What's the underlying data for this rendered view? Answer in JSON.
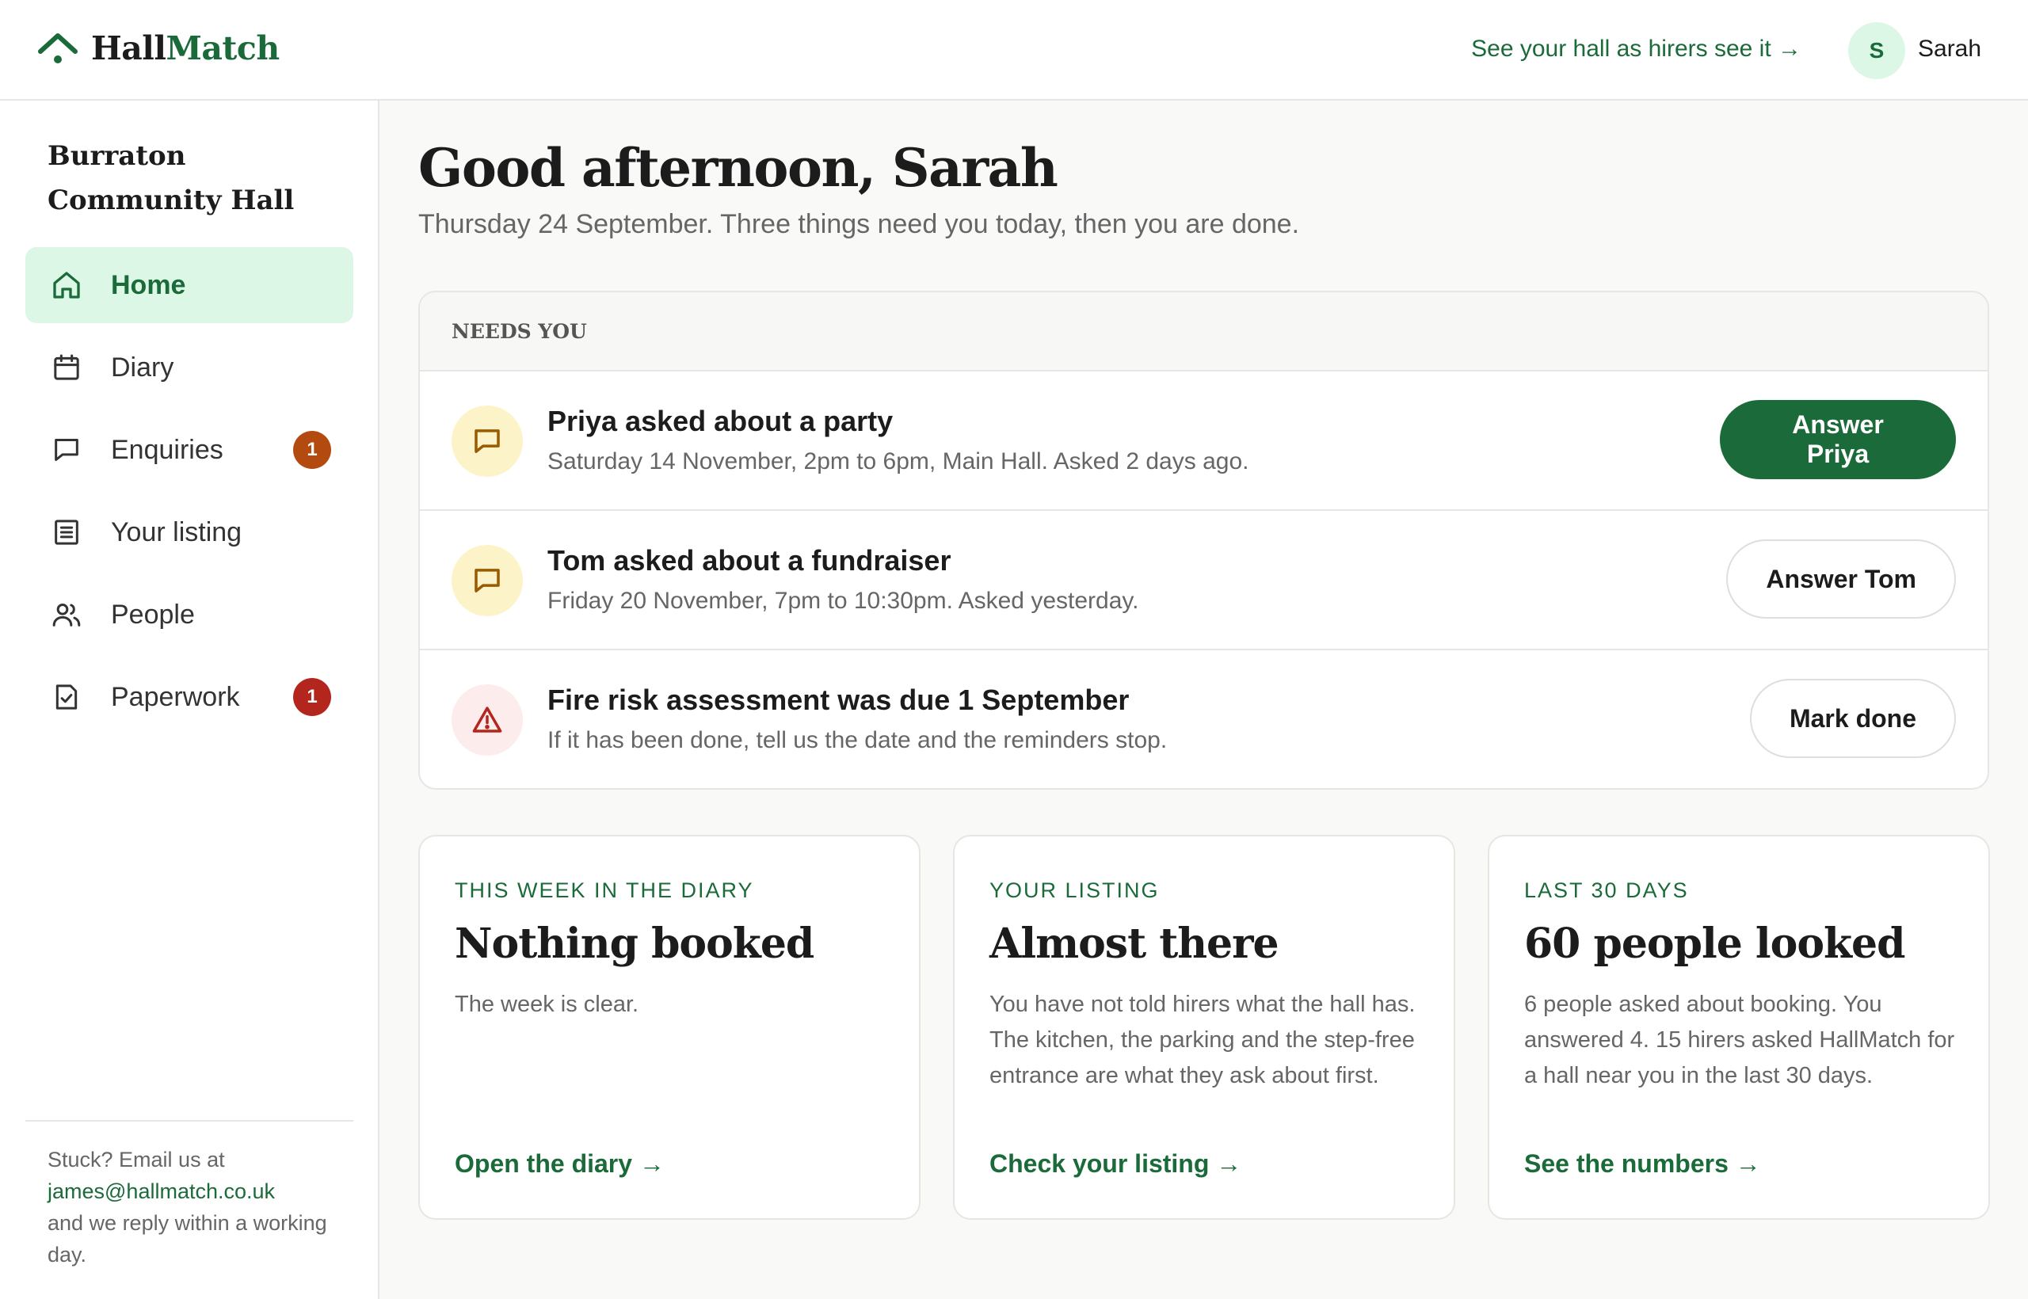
{
  "brand": {
    "name_part1": "Hall",
    "name_part2": "Match",
    "icon": "roof-pin-logo-icon",
    "color": "#1b6b3a"
  },
  "header": {
    "preview_link": "See your hall as hirers see it →",
    "avatar_initial": "S",
    "user_name": "Sarah"
  },
  "sidebar": {
    "venue_name": "Burraton Community Hall",
    "items": [
      {
        "label": "Home",
        "icon": "home-icon",
        "active": true
      },
      {
        "label": "Diary",
        "icon": "calendar-icon"
      },
      {
        "label": "Enquiries",
        "icon": "chat-bubble-icon",
        "badge": "1",
        "badge_color": "#b34a0f"
      },
      {
        "label": "Your listing",
        "icon": "document-list-icon"
      },
      {
        "label": "People",
        "icon": "people-icon"
      },
      {
        "label": "Paperwork",
        "icon": "document-check-icon",
        "badge": "1",
        "badge_color": "#b3261e"
      }
    ],
    "help": {
      "line1": "Stuck? Email us at",
      "email": "james@hallmatch.co.uk",
      "line2": "and we reply within a working day."
    }
  },
  "main": {
    "greeting": "Good afternoon, Sarah",
    "subline": "Thursday 24 September. Three things need you today, then you are done.",
    "needs": {
      "title": "NEEDS YOU",
      "tasks": [
        {
          "title": "Priya asked about a party",
          "desc": "Saturday 14 November, 2pm to 6pm, Main Hall. Asked 2 days ago.",
          "action": "Answer Priya",
          "icon": "chat-bubble-icon",
          "icon_bg": "#fdf3c9",
          "icon_color": "#9a5b00"
        },
        {
          "title": "Tom asked about a fundraiser",
          "desc": "Friday 20 November, 7pm to 10:30pm. Asked yesterday.",
          "action": "Answer Tom",
          "icon": "chat-bubble-icon",
          "icon_bg": "#fdf3c9",
          "icon_color": "#9a5b00"
        },
        {
          "title": "Fire risk assessment was due 1 September",
          "desc": "If it has been done, tell us the date and the reminders stop.",
          "action": "Mark done",
          "icon": "warning-triangle-icon",
          "icon_bg": "#fdecec",
          "icon_color": "#b3261e"
        }
      ]
    },
    "cards": [
      {
        "eyebrow": "THIS WEEK IN THE DIARY",
        "heading": "Nothing booked",
        "body": "The week is clear.",
        "link": "Open the diary →"
      },
      {
        "eyebrow": "YOUR LISTING",
        "heading": "Almost there",
        "body": "You have not told hirers what the hall has. The kitchen, the parking and the step-free entrance are what they ask about first.",
        "link": "Check your listing →"
      },
      {
        "eyebrow": "LAST 30 DAYS",
        "heading": "60 people looked",
        "body": "6 people asked about booking. You answered 4. 15 hirers asked HallMatch for a hall near you in the last 30 days.",
        "link": "See the numbers →"
      }
    ]
  }
}
